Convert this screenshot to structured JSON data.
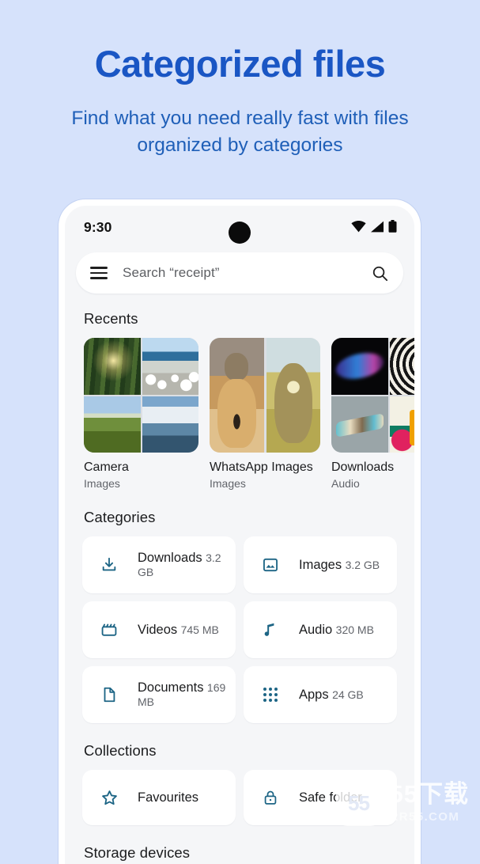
{
  "promo": {
    "title": "Categorized files",
    "subtitle": "Find what you need really fast with files organized by categories",
    "title_color": "#1a56c4",
    "subtitle_color": "#1f5fb8",
    "background_color": "#d6e2fb"
  },
  "status_bar": {
    "time": "9:30",
    "icons": [
      "wifi-icon",
      "cellular-signal-icon",
      "battery-icon"
    ]
  },
  "search": {
    "menu_icon": "hamburger-menu-icon",
    "placeholder": "Search “receipt”",
    "search_icon": "search-icon"
  },
  "recents": {
    "title": "Recents",
    "items": [
      {
        "name": "Camera",
        "type": "Images",
        "thumb_layout": "quad",
        "tiles": [
          "t-forest",
          "t-sheep",
          "t-mountain",
          "t-coast"
        ]
      },
      {
        "name": "WhatsApp Images",
        "type": "Images",
        "thumb_layout": "duo",
        "tiles": [
          "t-catdog",
          "t-dogflower"
        ]
      },
      {
        "name": "Downloads",
        "type": "Audio",
        "thumb_layout": "quad",
        "tiles": [
          "t-wave",
          "t-swirl",
          "t-ribbon",
          "t-colorful"
        ]
      }
    ]
  },
  "categories": {
    "title": "Categories",
    "icon_color": "#1d6585",
    "items": [
      {
        "label": "Downloads",
        "size": "3.2 GB",
        "icon": "download-icon"
      },
      {
        "label": "Images",
        "size": "3.2 GB",
        "icon": "image-icon"
      },
      {
        "label": "Videos",
        "size": "745 MB",
        "icon": "video-clapperboard-icon"
      },
      {
        "label": "Audio",
        "size": "320 MB",
        "icon": "music-note-icon"
      },
      {
        "label": "Documents",
        "size": "169 MB",
        "icon": "document-icon"
      },
      {
        "label": "Apps",
        "size": "24 GB",
        "icon": "apps-grid-icon"
      }
    ]
  },
  "collections": {
    "title": "Collections",
    "items": [
      {
        "label": "Favourites",
        "icon": "star-icon"
      },
      {
        "label": "Safe folder",
        "icon": "lock-icon"
      }
    ]
  },
  "storage": {
    "title": "Storage devices"
  },
  "watermark": {
    "badge": "55",
    "main": "55下载",
    "sub": "RR55.COM"
  }
}
